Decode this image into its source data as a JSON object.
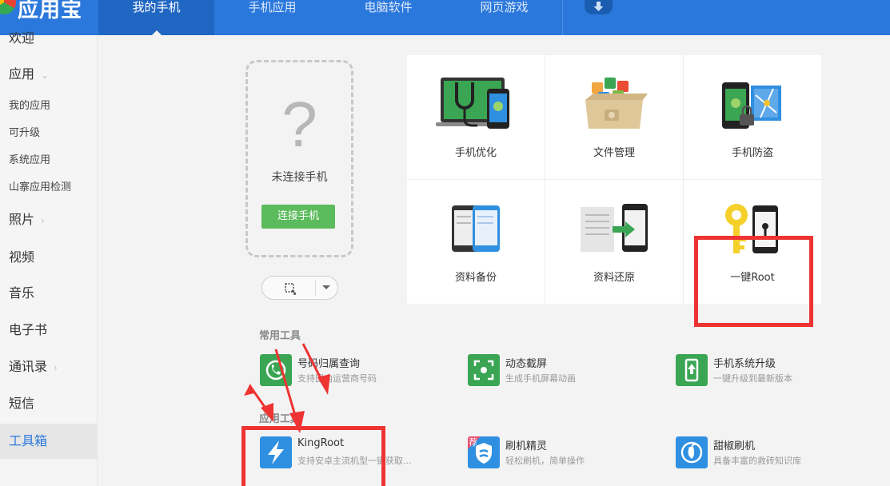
{
  "app": {
    "name": "应用宝"
  },
  "nav": {
    "tabs": [
      {
        "label": "我的手机",
        "active": true
      },
      {
        "label": "手机应用",
        "active": false
      },
      {
        "label": "电脑软件",
        "active": false
      },
      {
        "label": "网页游戏",
        "active": false
      }
    ],
    "download_icon": "download-arrow-icon"
  },
  "sidebar": {
    "items": [
      {
        "label": "欢迎"
      },
      {
        "label": "应用"
      },
      {
        "label": "我的应用"
      },
      {
        "label": "可升级"
      },
      {
        "label": "系统应用"
      },
      {
        "label": "山寨应用检测"
      },
      {
        "label": "照片"
      },
      {
        "label": "视频"
      },
      {
        "label": "音乐"
      },
      {
        "label": "电子书"
      },
      {
        "label": "通讯录"
      },
      {
        "label": "短信"
      },
      {
        "label": "工具箱"
      }
    ]
  },
  "phone": {
    "placeholder_glyph": "?",
    "status": "未连接手机",
    "connect_label": "连接手机"
  },
  "features": [
    {
      "label": "手机优化",
      "icon": "phone-optimize-icon"
    },
    {
      "label": "文件管理",
      "icon": "file-manager-icon"
    },
    {
      "label": "手机防盗",
      "icon": "anti-theft-icon"
    },
    {
      "label": "资料备份",
      "icon": "data-backup-icon"
    },
    {
      "label": "资料还原",
      "icon": "data-restore-icon"
    },
    {
      "label": "一键Root",
      "icon": "one-click-root-icon"
    }
  ],
  "common_tools": {
    "title": "常用工具",
    "items": [
      {
        "name": "号码归属查询",
        "desc": "支持国内运营商号码",
        "icon": "phone-lookup-icon",
        "color": "#3aa654"
      },
      {
        "name": "动态截屏",
        "desc": "生成手机屏幕动画",
        "icon": "screen-capture-icon",
        "color": "#3aa654"
      },
      {
        "name": "手机系统升级",
        "desc": "一键升级到最新版本",
        "icon": "system-upgrade-icon",
        "color": "#3aa654"
      }
    ]
  },
  "app_tools": {
    "title": "应用工具",
    "items": [
      {
        "name": "KingRoot",
        "desc": "支持安卓主流机型一键获取...",
        "icon": "kingroot-icon",
        "color": "#2f8fe0"
      },
      {
        "name": "刷机精灵",
        "desc": "轻松刷机，简单操作",
        "icon": "flash-wizard-icon",
        "color": "#2f8fe0",
        "badge": "荐"
      },
      {
        "name": "甜椒刷机",
        "desc": "具备丰富的救砖知识库",
        "icon": "tianjiao-flash-icon",
        "color": "#2f8fe0"
      }
    ]
  },
  "colors": {
    "topbar": "#2b78dc",
    "active_tab": "#2066c3",
    "connect": "#5cbb5c",
    "annotation": "#ee3333"
  }
}
